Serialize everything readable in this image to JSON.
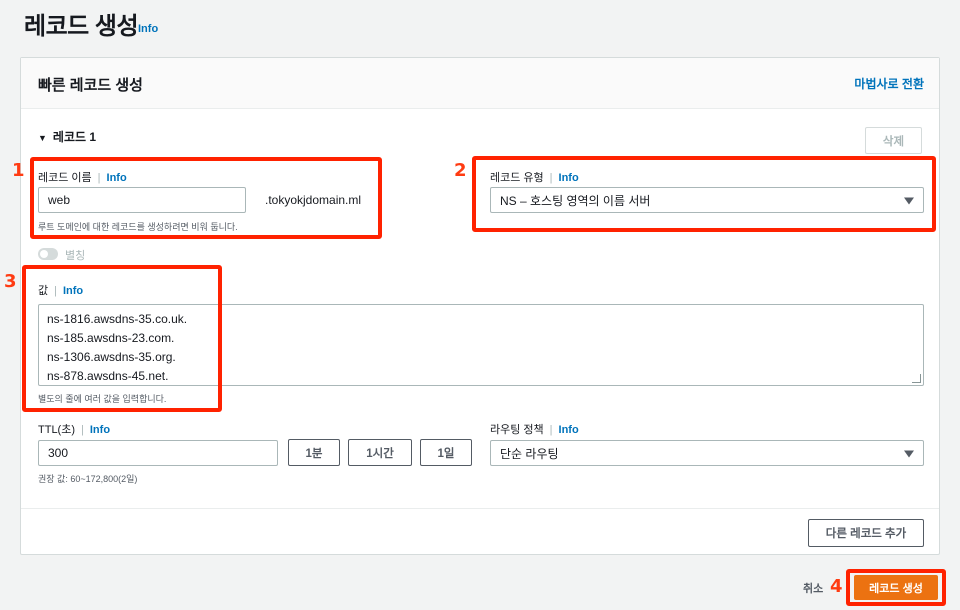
{
  "page": {
    "title": "레코드 생성",
    "title_info": "Info"
  },
  "panel": {
    "title": "빠른 레코드 생성",
    "wizard_link": "마법사로 전환",
    "record_toggle": "레코드 1",
    "delete_label": "삭제"
  },
  "record_name": {
    "label": "레코드 이름",
    "info": "Info",
    "value": "web",
    "domain_suffix": ".tokyokjdomain.ml",
    "hint": "루트 도메인에 대한 레코드를 생성하려면 비워 둡니다."
  },
  "record_type": {
    "label": "레코드 유형",
    "info": "Info",
    "selected": "NS – 호스팅 영역의 이름 서버"
  },
  "alias": {
    "label": "별칭",
    "enabled": false
  },
  "value_field": {
    "label": "값",
    "info": "Info",
    "lines": [
      "ns-1816.awsdns-35.co.uk.",
      "ns-185.awsdns-23.com.",
      "ns-1306.awsdns-35.org.",
      "ns-878.awsdns-45.net."
    ],
    "hint": "별도의 줄에 여러 값을 입력합니다."
  },
  "ttl": {
    "label": "TTL(초)",
    "info": "Info",
    "value": "300",
    "presets": [
      "1분",
      "1시간",
      "1일"
    ],
    "hint": "권장 값: 60~172,800(2일)"
  },
  "routing": {
    "label": "라우팅 정책",
    "info": "Info",
    "selected": "단순 라우팅"
  },
  "actions": {
    "add_record": "다른 레코드 추가",
    "cancel": "취소",
    "create": "레코드 생성"
  },
  "annotations": {
    "step1": "1",
    "step2": "2",
    "step3": "3",
    "step4": "4"
  },
  "colors": {
    "primary": "#ec7211",
    "link": "#0073bb",
    "annotation": "#ff2200"
  }
}
